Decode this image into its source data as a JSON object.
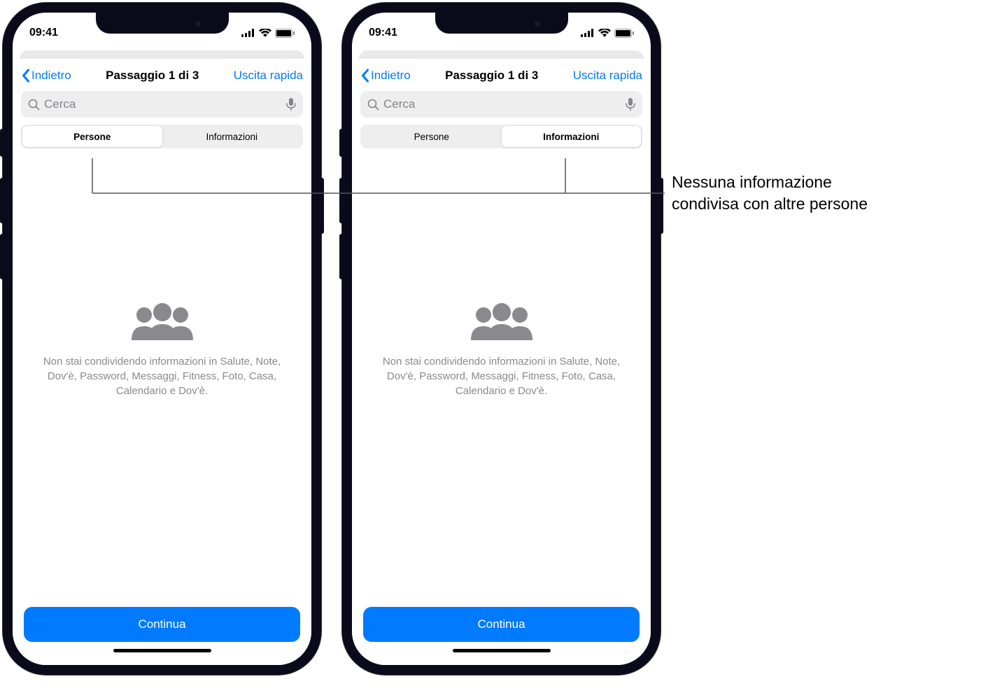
{
  "status": {
    "time": "09:41"
  },
  "nav": {
    "back": "Indietro",
    "title": "Passaggio 1 di 3",
    "quick_exit": "Uscita rapida"
  },
  "search": {
    "placeholder": "Cerca"
  },
  "segments": {
    "people": "Persone",
    "info": "Informazioni"
  },
  "empty_state": {
    "text": "Non stai condividendo informazioni in Salute, Note, Dov'è, Password, Messaggi, Fitness, Foto, Casa, Calendario e Dov'è."
  },
  "continue": "Continua",
  "callout": {
    "line1": "Nessuna informazione",
    "line2": "condivisa con altre persone"
  }
}
